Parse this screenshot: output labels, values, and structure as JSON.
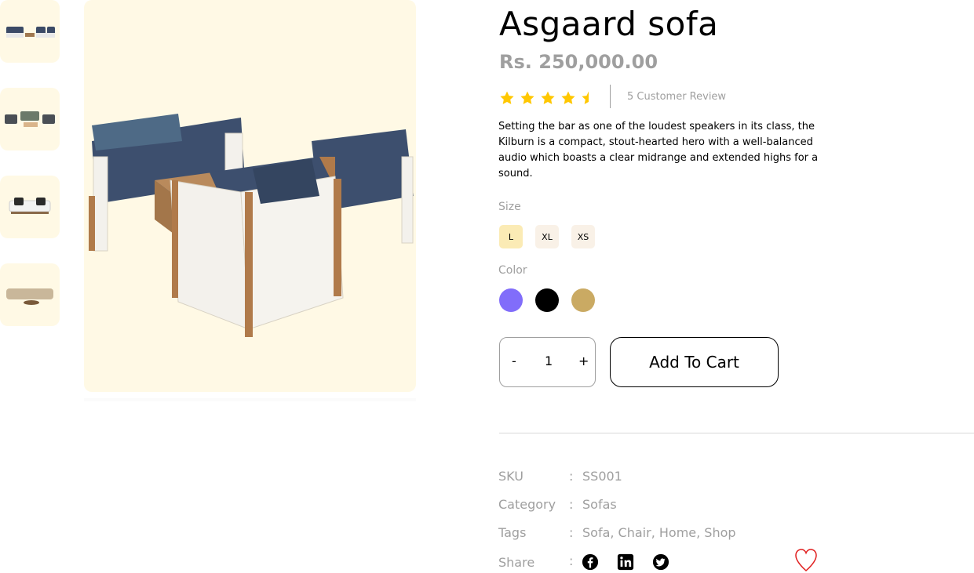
{
  "thumbnails": [
    {
      "alt": "sofa-set-thumbnail-1"
    },
    {
      "alt": "sofa-set-thumbnail-2"
    },
    {
      "alt": "sofa-thumbnail-3"
    },
    {
      "alt": "sofa-thumbnail-4"
    }
  ],
  "product": {
    "title": "Asgaard sofa",
    "price": "Rs. 250,000.00",
    "rating": 4.5,
    "review_count_text": "5 Customer Review",
    "description": "Setting the bar as one of the loudest speakers in its class, the Kilburn is a compact, stout-hearted hero with a well-balanced audio which boasts a clear midrange and extended highs for a sound."
  },
  "size": {
    "label": "Size",
    "options": [
      "L",
      "XL",
      "XS"
    ],
    "selected": "L"
  },
  "color": {
    "label": "Color",
    "options": [
      "#816DFA",
      "#000000",
      "#B88E2F"
    ]
  },
  "quantity": {
    "minus_label": "-",
    "value": "1",
    "plus_label": "+"
  },
  "cart": {
    "label": "Add To Cart"
  },
  "meta": {
    "sku_key": "SKU",
    "sku_value": "SS001",
    "category_key": "Category",
    "category_value": "Sofas",
    "tags_key": "Tags",
    "tags_value": "Sofa, Chair, Home, Shop",
    "share_key": "Share",
    "colon": ":"
  },
  "icons": {
    "share": [
      "facebook-icon",
      "linkedin-icon",
      "twitter-icon"
    ],
    "wishlist": "heart-icon"
  },
  "colors": {
    "star": "#FFC700",
    "muted_text": "#9F9F9F",
    "thumb_bg": "#FFF9E5",
    "size_active_bg": "#FBEBB5",
    "size_bg": "#F9F1E7",
    "wishlist": "#E01E1E"
  }
}
